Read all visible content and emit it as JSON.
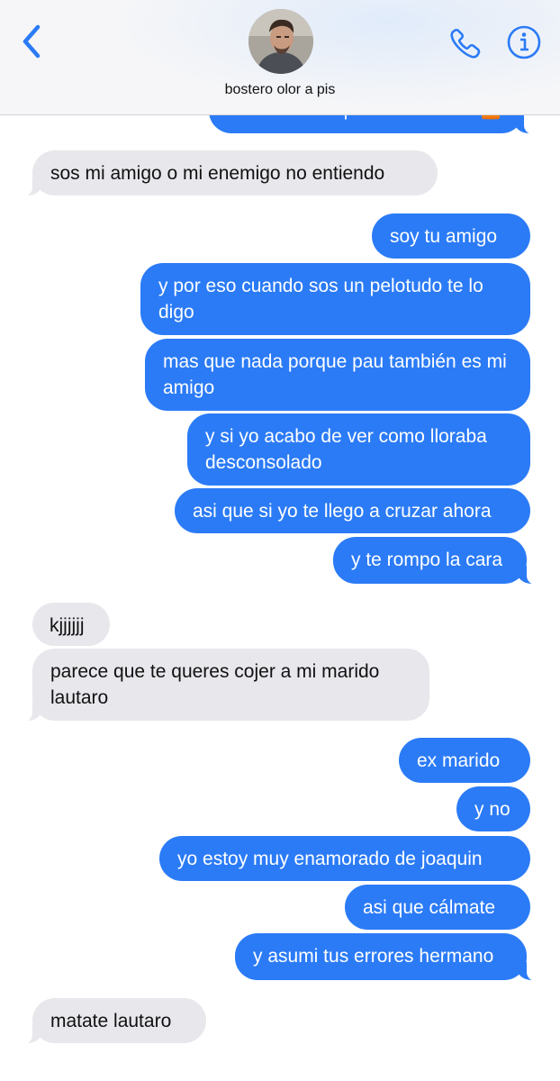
{
  "contact": {
    "name": "bostero olor a pis"
  },
  "colors": {
    "accent": "#2b7bf6",
    "incoming_bubble": "#e7e7ec",
    "header_bg": "#f6f6f8"
  },
  "icons": {
    "back": "chevron-left-icon",
    "phone": "phone-icon",
    "info": "info-icon"
  },
  "messages": [
    {
      "from": "me",
      "text": "el sol no se tapa con un dedo 🤷"
    },
    {
      "from": "them",
      "text": "sos mi amigo o mi enemigo no entiendo"
    },
    {
      "from": "me",
      "text": "soy tu amigo"
    },
    {
      "from": "me",
      "text": "y por eso cuando sos un pelotudo te lo digo"
    },
    {
      "from": "me",
      "text": "mas que nada porque pau también es mi amigo"
    },
    {
      "from": "me",
      "text": "y si yo acabo de ver como lloraba desconsolado"
    },
    {
      "from": "me",
      "text": "asi que si yo te llego a cruzar ahora"
    },
    {
      "from": "me",
      "text": "y te rompo la cara"
    },
    {
      "from": "them",
      "text": "kjjjjjj"
    },
    {
      "from": "them",
      "text": "parece que te queres cojer a mi marido lautaro"
    },
    {
      "from": "me",
      "text": "ex marido"
    },
    {
      "from": "me",
      "text": "y no"
    },
    {
      "from": "me",
      "text": "yo estoy muy enamorado de joaquin"
    },
    {
      "from": "me",
      "text": "asi que cálmate"
    },
    {
      "from": "me",
      "text": "y asumi tus errores hermano"
    },
    {
      "from": "them",
      "text": "matate lautaro"
    }
  ]
}
